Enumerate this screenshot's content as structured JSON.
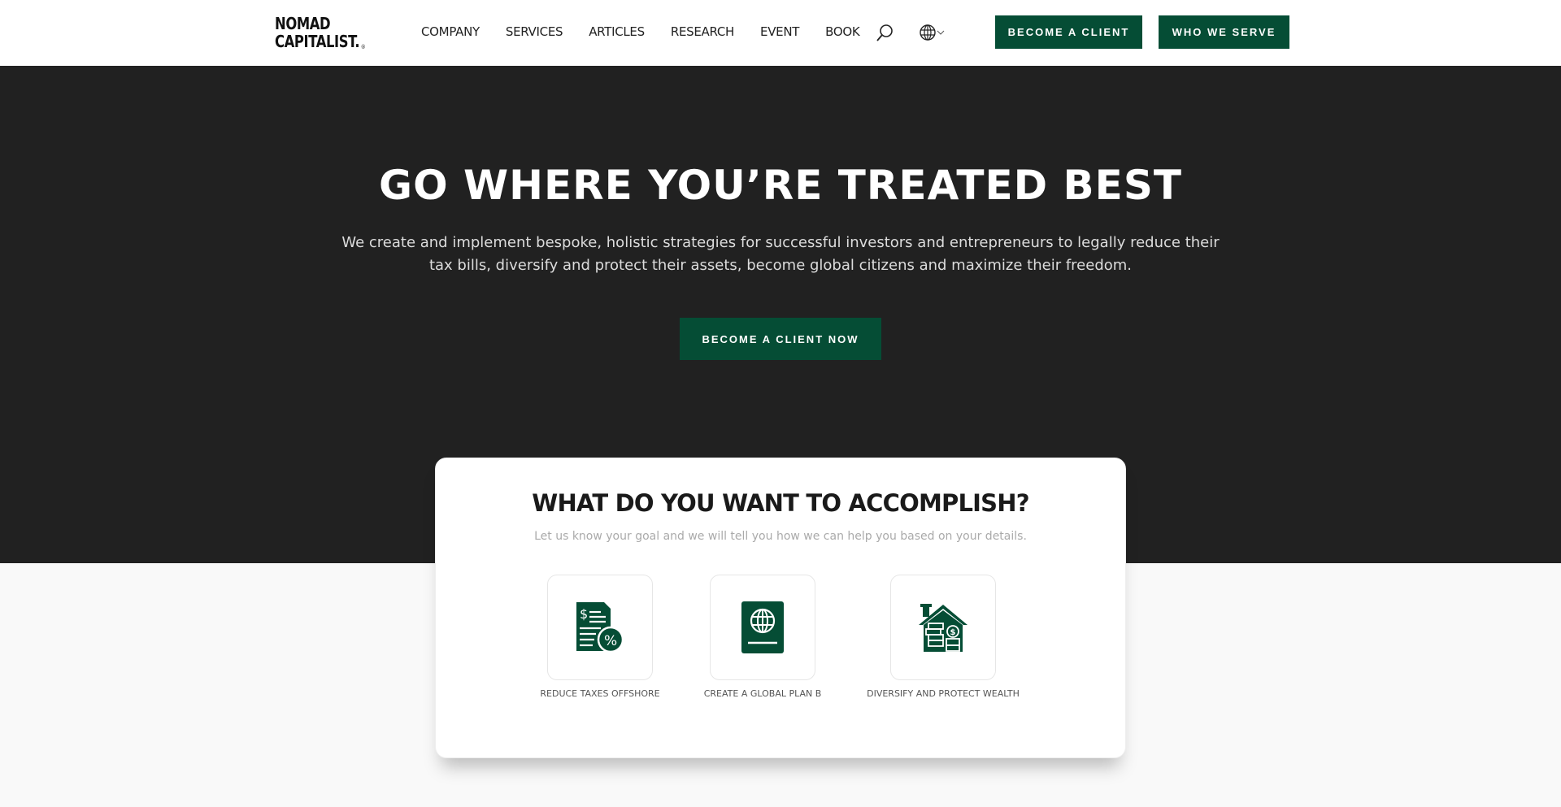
{
  "header": {
    "logo_line1": "NOMAD",
    "logo_line2": "CAPITALIST.",
    "logo_mark": "®",
    "nav": [
      "COMPANY",
      "SERVICES",
      "ARTICLES",
      "RESEARCH",
      "EVENT",
      "BOOK"
    ],
    "search_icon": "search-icon",
    "language_icon": "globe-icon",
    "become_client_label": "BECOME A CLIENT",
    "who_we_serve_label": "WHO WE SERVE"
  },
  "hero": {
    "title": "GO WHERE YOU’RE TREATED BEST",
    "description": "We create and implement bespoke, holistic strategies for successful investors and entrepreneurs to legally reduce their tax bills, diversify and protect their assets, become global citizens and maximize their freedom.",
    "cta_label": "BECOME A CLIENT NOW"
  },
  "goals": {
    "title": "WHAT DO YOU WANT TO ACCOMPLISH?",
    "subtitle": "Let us know your goal and we will tell you how we can help you based on your details.",
    "options": [
      {
        "label": "REDUCE TAXES OFFSHORE",
        "icon": "tax-document-icon"
      },
      {
        "label": "CREATE A GLOBAL PLAN B",
        "icon": "passport-icon"
      },
      {
        "label": "DIVERSIFY AND PROTECT WEALTH",
        "icon": "house-coins-icon"
      }
    ]
  },
  "colors": {
    "brand_green": "#054d35",
    "hero_bg": "#212121"
  }
}
